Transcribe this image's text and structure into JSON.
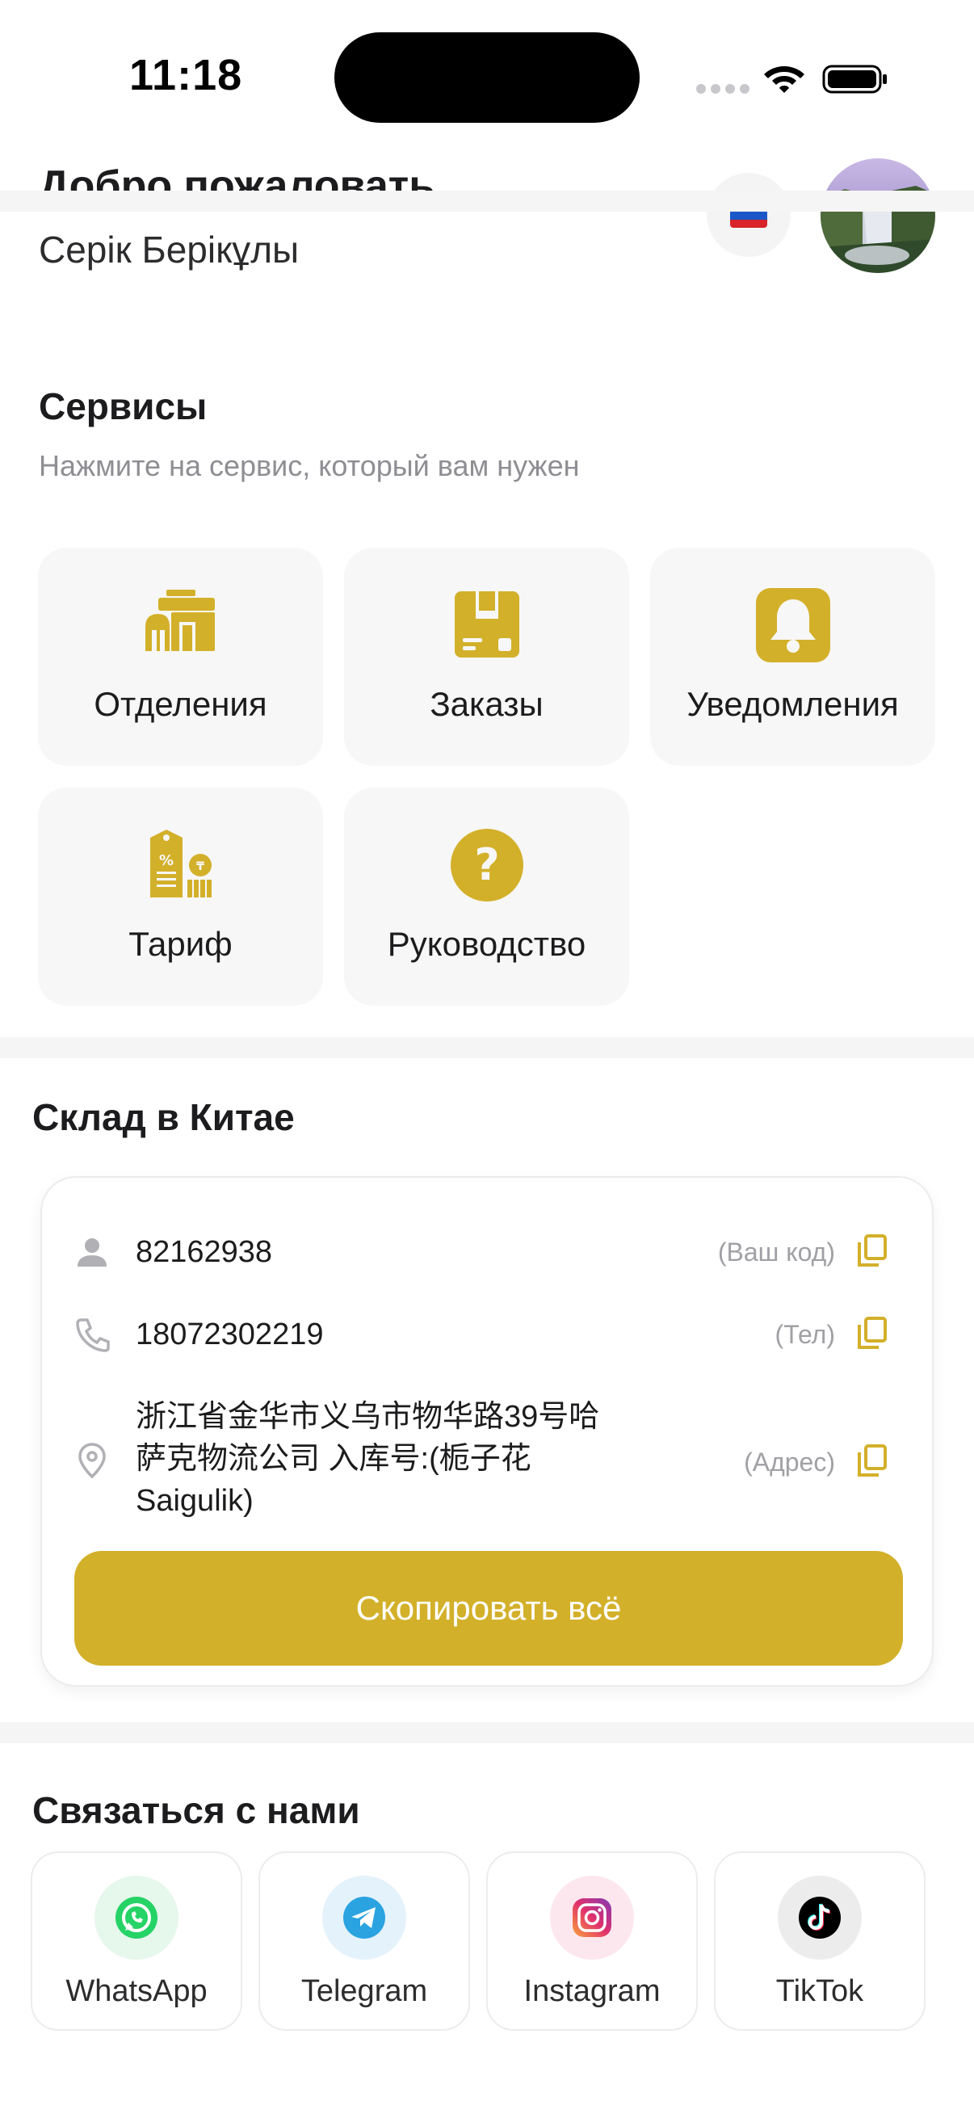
{
  "status_bar": {
    "time": "11:18"
  },
  "header": {
    "welcome": "Добро пожаловать",
    "username": "Серік Берікұлы"
  },
  "services": {
    "title": "Сервисы",
    "subtitle": "Нажмите на сервис, который вам нужен",
    "items": [
      {
        "label": "Отделения",
        "icon": "branch-building-icon"
      },
      {
        "label": "Заказы",
        "icon": "package-box-icon"
      },
      {
        "label": "Уведомления",
        "icon": "bell-icon"
      },
      {
        "label": "Тариф",
        "icon": "tariff-price-tag-icon"
      },
      {
        "label": "Руководство",
        "icon": "question-circle-icon"
      }
    ]
  },
  "warehouse": {
    "title": "Склад в Китае",
    "code_value": "82162938",
    "code_tag": "(Ваш код)",
    "phone_value": "18072302219",
    "phone_tag": "(Тел)",
    "address_line1": "浙江省金华市义乌市物华路39号哈",
    "address_line2": "萨克物流公司 入库号:(栀子花",
    "address_line3": "Saigulik)",
    "address_tag": "(Адрес)",
    "copy_all_label": "Скопировать всё"
  },
  "contact": {
    "title": "Связаться с нами",
    "items": [
      {
        "label": "WhatsApp",
        "icon": "whatsapp-icon"
      },
      {
        "label": "Telegram",
        "icon": "telegram-icon"
      },
      {
        "label": "Instagram",
        "icon": "instagram-icon"
      },
      {
        "label": "TikTok",
        "icon": "tiktok-icon"
      }
    ]
  },
  "colors": {
    "accent": "#d3b02a",
    "card_bg": "#f7f7f7",
    "muted_text": "#8e8e93"
  }
}
